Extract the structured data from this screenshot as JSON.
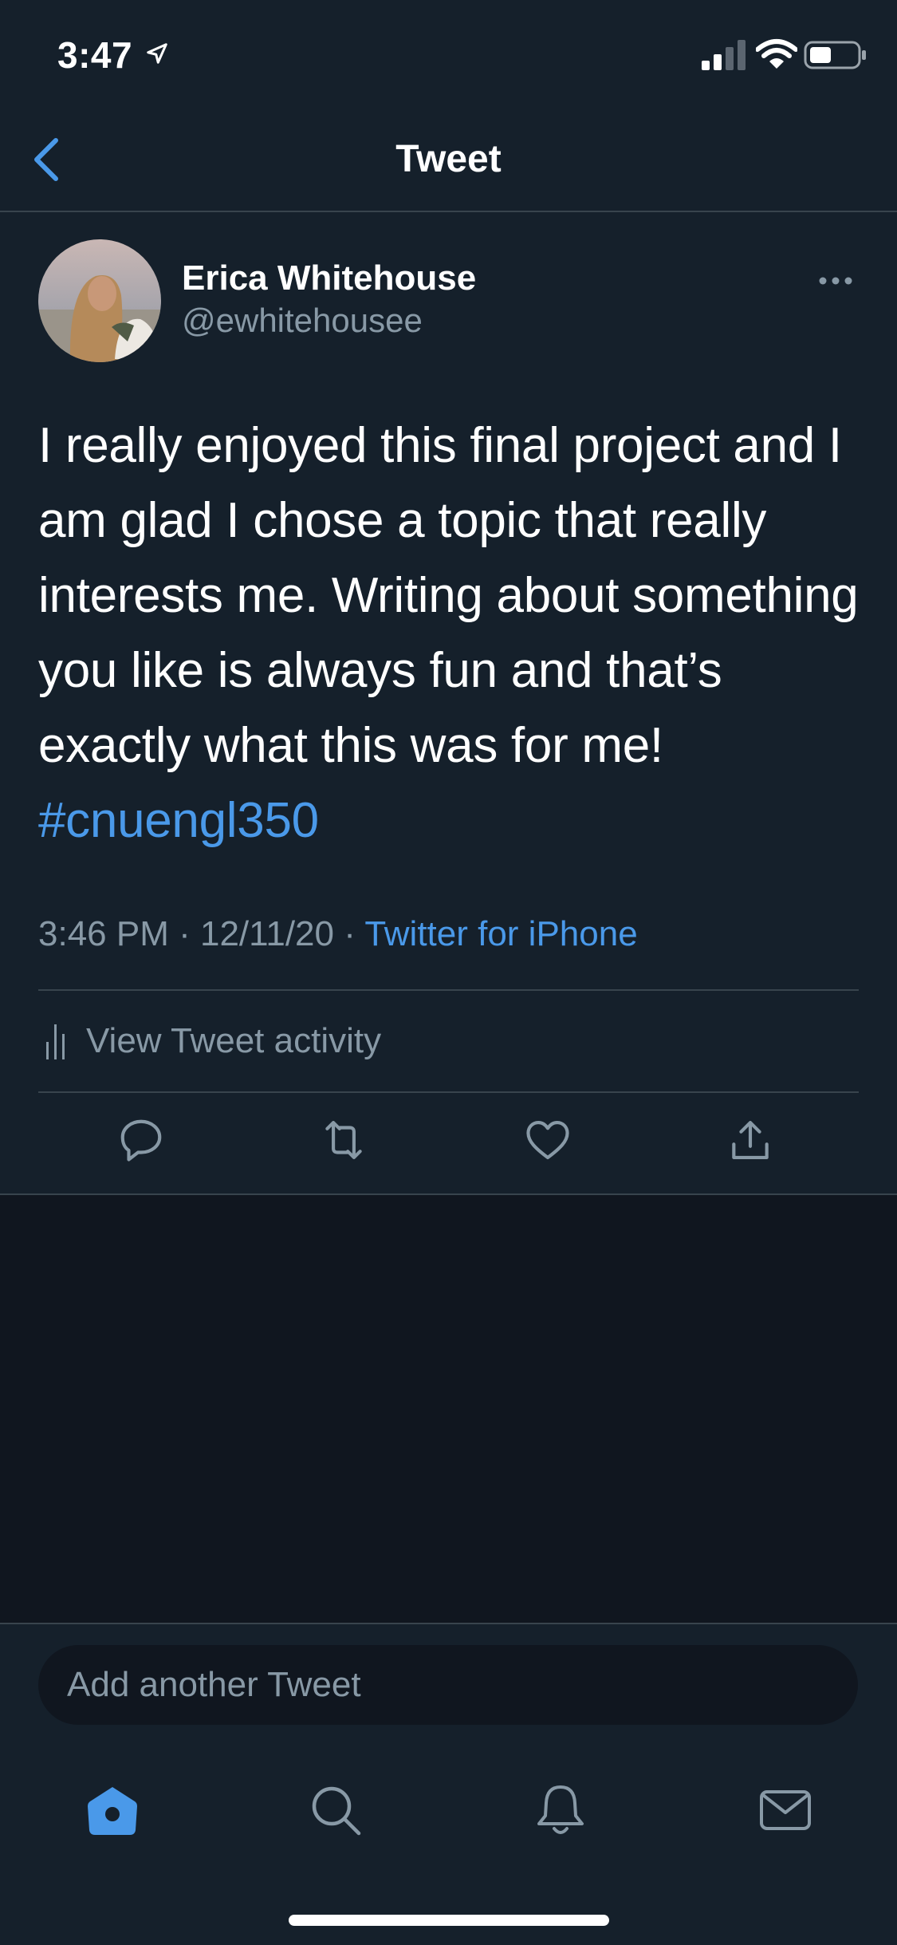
{
  "status_bar": {
    "time": "3:47",
    "icons": [
      "location-arrow-icon",
      "cellular-signal-icon",
      "wifi-icon",
      "battery-icon"
    ]
  },
  "nav": {
    "title": "Tweet",
    "back_icon": "chevron-left-icon"
  },
  "tweet": {
    "author_name": "Erica Whitehouse",
    "author_handle": "@ewhitehousee",
    "text": "I really enjoyed this final project and I am glad I chose a topic that really interests me. Writing about something you like is always fun and that’s exactly what this was for me!",
    "hashtag": "#cnuengl350",
    "time": "3:46 PM",
    "date": "12/11/20",
    "separator": " · ",
    "source": "Twitter for iPhone",
    "activity_label": "View Tweet activity"
  },
  "actions": [
    {
      "name": "reply",
      "icon": "reply-icon"
    },
    {
      "name": "retweet",
      "icon": "retweet-icon"
    },
    {
      "name": "like",
      "icon": "heart-icon"
    },
    {
      "name": "share",
      "icon": "share-icon"
    }
  ],
  "compose": {
    "placeholder": "Add another Tweet"
  },
  "tab_bar": {
    "tabs": [
      "home",
      "search",
      "notifications",
      "messages"
    ],
    "active": "home"
  },
  "colors": {
    "background": "#15202b",
    "accent": "#4a99e9",
    "secondary_text": "#8899a6",
    "divider": "#38444d"
  }
}
